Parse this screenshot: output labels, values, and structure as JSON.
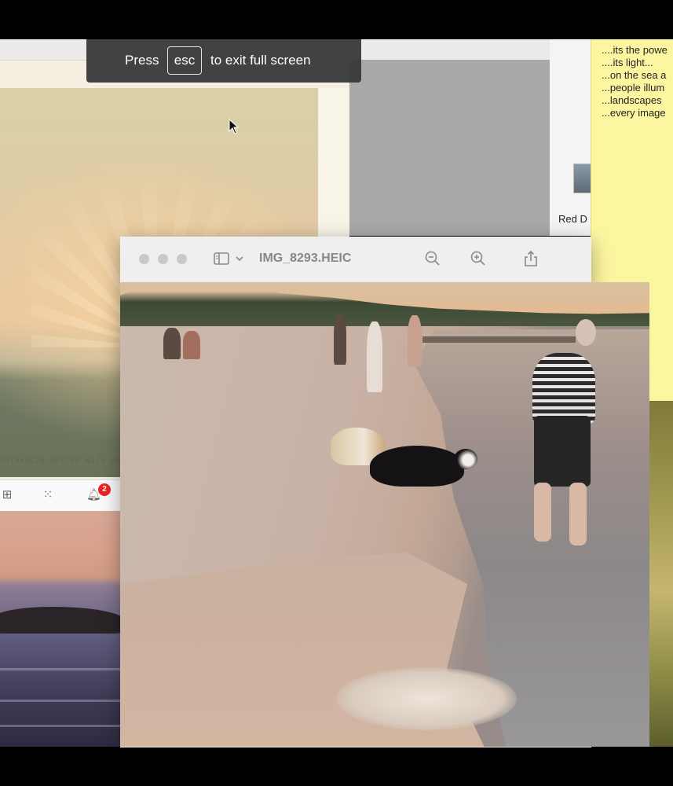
{
  "fullscreen_banner": {
    "prefix": "Press",
    "key": "esc",
    "suffix": "to exit full screen"
  },
  "print_caption": "SSTRAHLEN  WELCHE NACH DEM G",
  "left_toolbar": {
    "notification_count": "2"
  },
  "finder": {
    "item_label": "Red D"
  },
  "sticky_note": {
    "lines": [
      "....its the powe",
      "....its light...",
      "...on the sea a",
      "...people illum",
      "...landscapes",
      "...every image"
    ]
  },
  "preview": {
    "title": "IMG_8293.HEIC",
    "icons": [
      "sidebar-icon",
      "chevron-down-icon",
      "zoom-out-icon",
      "zoom-in-icon",
      "share-icon"
    ]
  },
  "colors": {
    "sticky": "#fdf6a0",
    "banner": "#383a3c",
    "badge": "#e22222"
  }
}
